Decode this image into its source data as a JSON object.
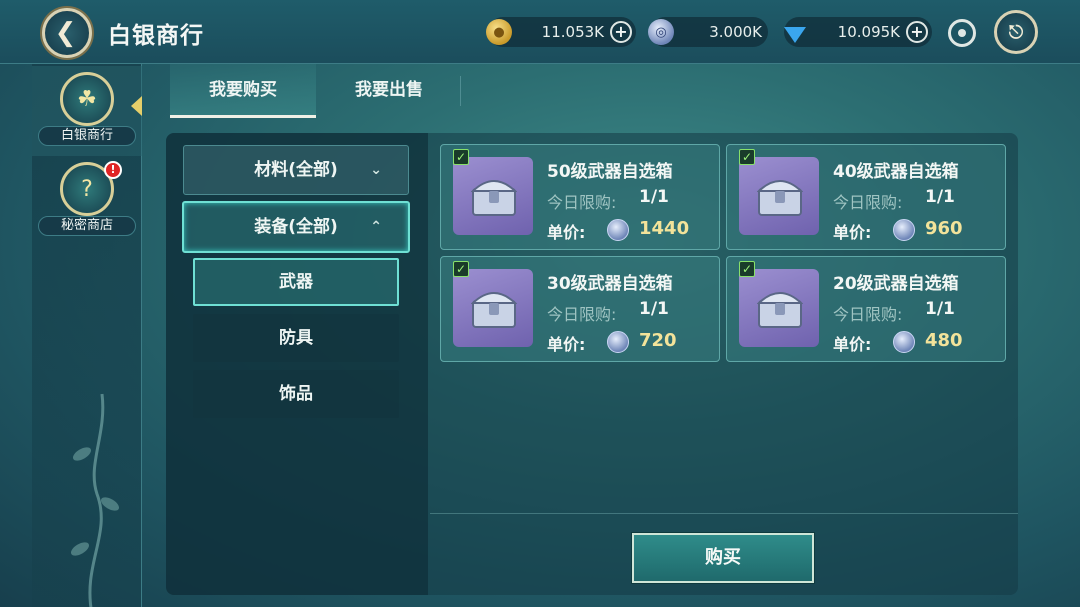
{
  "header": {
    "title": "白银商行",
    "currencies": [
      {
        "icon": "gold-coin-icon",
        "value": "11.053K"
      },
      {
        "icon": "silver-coin-icon",
        "value": "3.000K"
      },
      {
        "icon": "diamond-icon",
        "value": "10.095K"
      }
    ],
    "plus_symbol": "+"
  },
  "sidenav": {
    "items": [
      {
        "label": "白银商行",
        "active": true
      },
      {
        "label": "秘密商店",
        "badge": "!"
      }
    ]
  },
  "tabs": [
    {
      "label": "我要购买",
      "active": true
    },
    {
      "label": "我要出售"
    }
  ],
  "categories": [
    {
      "label": "材料(全部)",
      "expanded": false
    },
    {
      "label": "装备(全部)",
      "expanded": true,
      "children": [
        {
          "label": "武器",
          "selected": true
        },
        {
          "label": "防具"
        },
        {
          "label": "饰品"
        }
      ]
    }
  ],
  "items": [
    {
      "name": "50级武器自选箱",
      "limit_label": "今日限购:",
      "limit": "1/1",
      "price_label": "单价:",
      "price": "1440"
    },
    {
      "name": "40级武器自选箱",
      "limit_label": "今日限购:",
      "limit": "1/1",
      "price_label": "单价:",
      "price": "960"
    },
    {
      "name": "30级武器自选箱",
      "limit_label": "今日限购:",
      "limit": "1/1",
      "price_label": "单价:",
      "price": "720"
    },
    {
      "name": "20级武器自选箱",
      "limit_label": "今日限购:",
      "limit": "1/1",
      "price_label": "单价:",
      "price": "480"
    }
  ],
  "buy_button": "购买",
  "colors": {
    "accent": "#6fe0d4",
    "price": "#f3e39a",
    "badge": "#e02424"
  }
}
